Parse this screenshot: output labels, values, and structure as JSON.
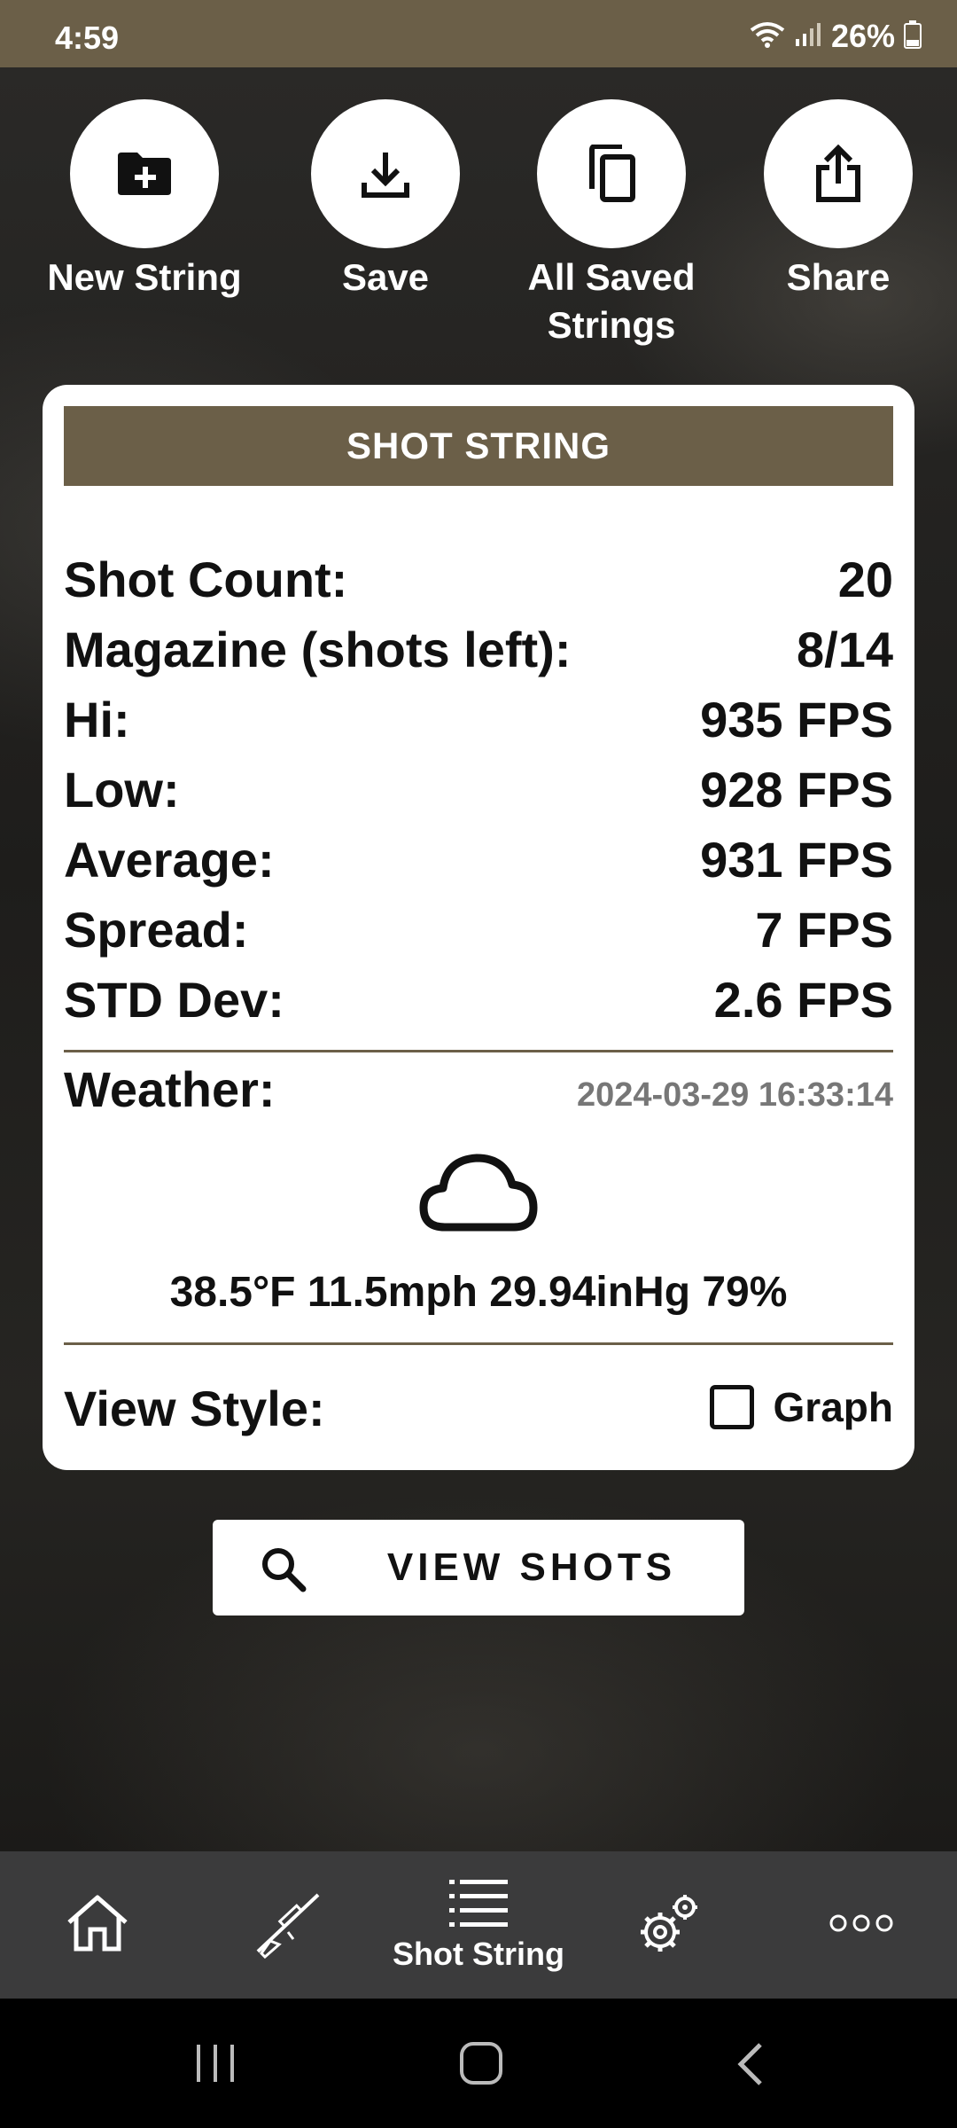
{
  "status_bar": {
    "time": "4:59",
    "battery": "26%"
  },
  "actions": [
    {
      "label": "New String",
      "icon": "folder-plus-icon"
    },
    {
      "label": "Save",
      "icon": "download-icon"
    },
    {
      "label": "All Saved Strings",
      "icon": "copy-icon"
    },
    {
      "label": "Share",
      "icon": "share-icon"
    }
  ],
  "card": {
    "title": "SHOT STRING",
    "stats": [
      {
        "label": "Shot Count:",
        "value": "20"
      },
      {
        "label": "Magazine (shots left):",
        "value": "8/14"
      },
      {
        "label": "Hi:",
        "value": "935 FPS"
      },
      {
        "label": "Low:",
        "value": "928 FPS"
      },
      {
        "label": "Average:",
        "value": "931 FPS"
      },
      {
        "label": "Spread:",
        "value": "7 FPS"
      },
      {
        "label": "STD Dev:",
        "value": "2.6 FPS"
      }
    ],
    "weather": {
      "label": "Weather:",
      "timestamp": "2024-03-29 16:33:14",
      "icon": "cloud-icon",
      "values": "38.5°F 11.5mph 29.94inHg 79%"
    },
    "view_style": {
      "label": "View Style:",
      "option_label": "Graph",
      "checked": false
    }
  },
  "view_shots_button": {
    "label": "VIEW SHOTS",
    "icon": "search-icon"
  },
  "bottom_nav": {
    "items": [
      {
        "icon": "home-icon",
        "label": ""
      },
      {
        "icon": "rifle-icon",
        "label": ""
      },
      {
        "icon": "list-icon",
        "label": "Shot String",
        "active": true
      },
      {
        "icon": "settings-icon",
        "label": ""
      },
      {
        "icon": "more-icon",
        "label": ""
      }
    ]
  },
  "colors": {
    "accent": "#6b5f48",
    "nav_bg": "#3b3b3c"
  }
}
